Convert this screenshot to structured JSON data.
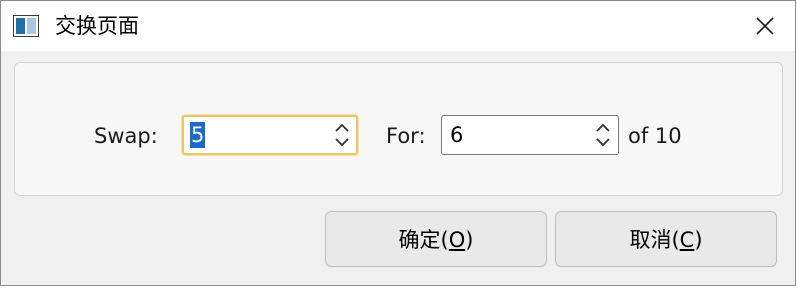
{
  "window": {
    "title": "交换页面",
    "icon": "window-split-icon"
  },
  "titlebar": {
    "close_icon": "close-icon"
  },
  "swap": {
    "label": "Swap:",
    "value": "5"
  },
  "for": {
    "label": "For:",
    "value": "6"
  },
  "of_text": "of 10",
  "buttons": {
    "ok": {
      "text": "确定(",
      "accel": "O",
      "suffix": ")"
    },
    "cancel": {
      "text": "取消(",
      "accel": "C",
      "suffix": ")"
    }
  },
  "colors": {
    "focus_border": "#e8c66a",
    "selection": "#1b69c9",
    "panel_bg": "#f7f7f7",
    "dialog_bg": "#f0f0f0"
  }
}
